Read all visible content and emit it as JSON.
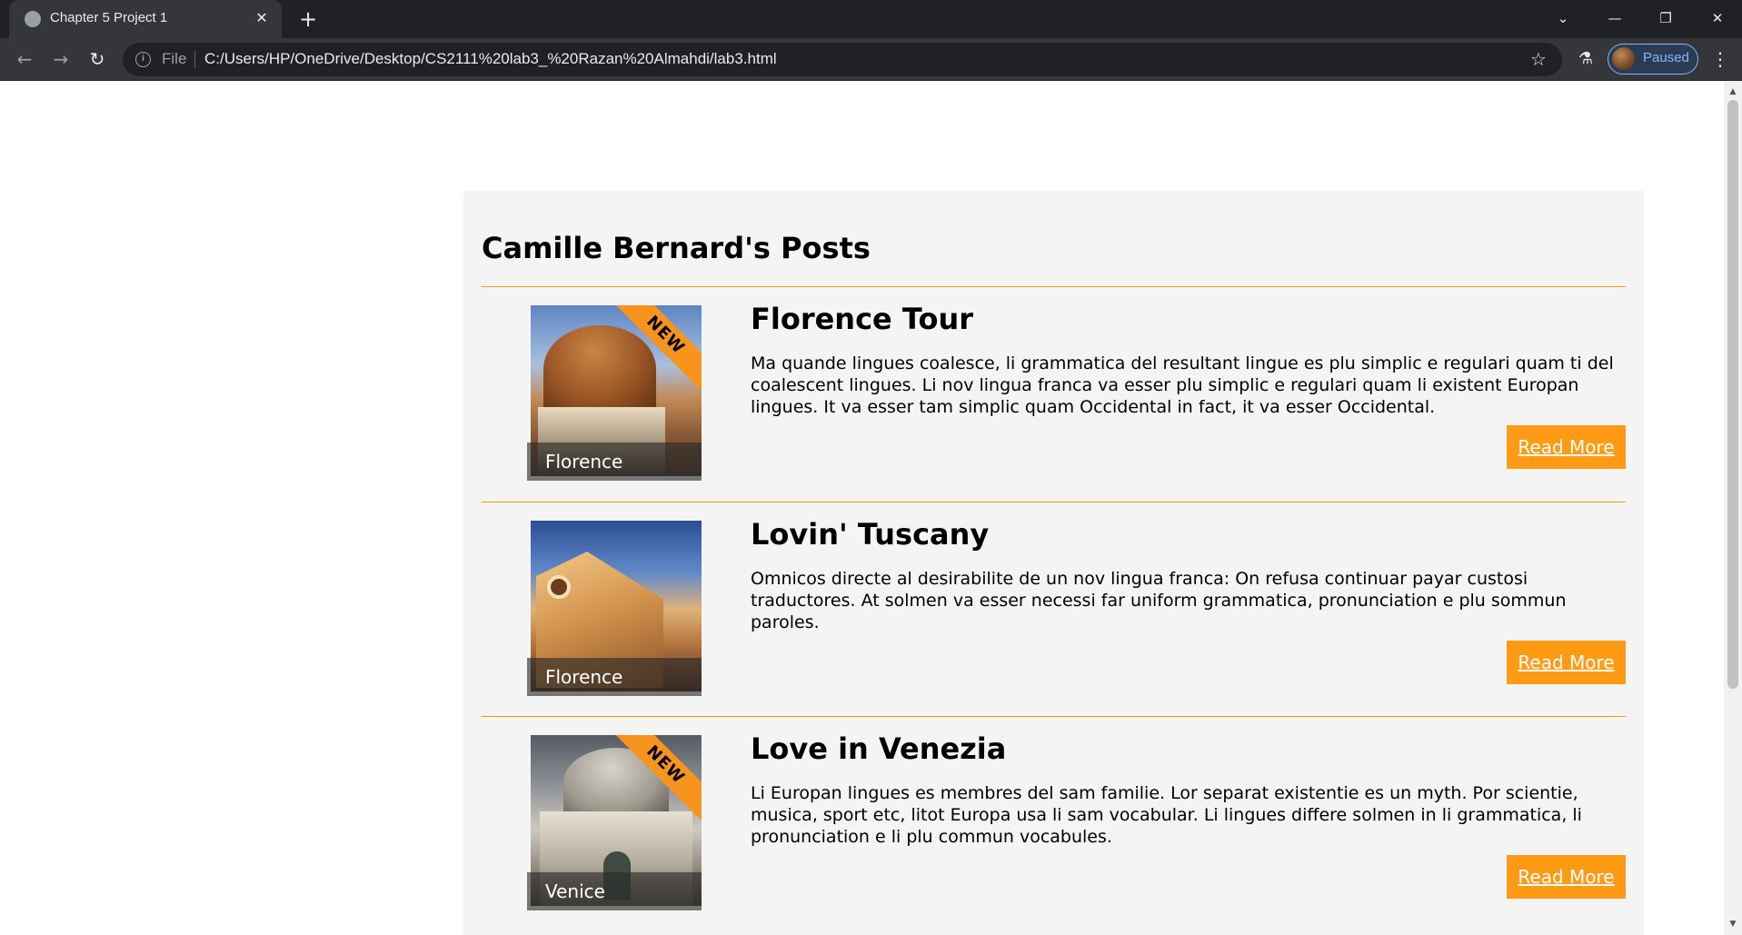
{
  "browser": {
    "tab": {
      "title": "Chapter 5 Project 1"
    },
    "address": {
      "scheme_label": "File",
      "url": "C:/Users/HP/OneDrive/Desktop/CS2111%20lab3_%20Razan%20Almahdi/lab3.html"
    },
    "profile": {
      "label": "Paused"
    }
  },
  "page": {
    "title": "Camille Bernard's Posts",
    "posts": [
      {
        "title": "Florence Tour",
        "body": "Ma quande lingues coalesce, li grammatica del resultant lingue es plu simplic e regulari quam ti del coalescent lingues. Li nov lingua franca va esser plu simplic e regulari quam li existent Europan lingues. It va esser tam simplic quam Occidental in fact, it va esser Occidental.",
        "caption": "Florence",
        "ribbon": "NEW",
        "button": "Read More"
      },
      {
        "title": "Lovin' Tuscany",
        "body": "Omnicos directe al desirabilite de un nov lingua franca: On refusa continuar payar custosi traductores. At solmen va esser necessi far uniform grammatica, pronunciation e plu sommun paroles.",
        "caption": "Florence",
        "button": "Read More"
      },
      {
        "title": "Love in Venezia",
        "body": "Li Europan lingues es membres del sam familie. Lor separat existentie es un myth. Por scientie, musica, sport etc, litot Europa usa li sam vocabular. Li lingues differe solmen in li grammatica, li pronunciation e li plu commun vocabules.",
        "caption": "Venice",
        "ribbon": "NEW",
        "button": "Read More"
      }
    ]
  },
  "colors": {
    "accent": "#ff9a14",
    "rule": "#f59a0f",
    "panel": "#f4f4f4"
  },
  "icons": [
    "globe-favicon-icon",
    "close-icon",
    "plus-icon",
    "chevron-down-icon",
    "minimize-icon",
    "restore-icon",
    "back-icon",
    "forward-icon",
    "reload-icon",
    "info-icon",
    "star-icon",
    "labs-icon",
    "menu-icon"
  ]
}
